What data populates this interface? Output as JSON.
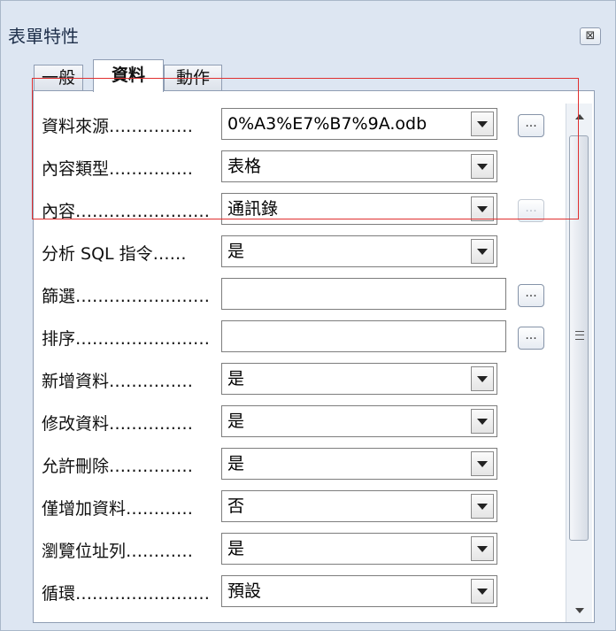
{
  "dialog": {
    "title": "表單特性",
    "close_label": "⊠"
  },
  "tabs": [
    {
      "label": "一般",
      "active": false
    },
    {
      "label": "資料",
      "active": true
    },
    {
      "label": "動作",
      "active": false
    }
  ],
  "rows": [
    {
      "label": "資料來源……………",
      "value": "0%A3%E7%B7%9A.odb",
      "control": "dropdown",
      "more_button": true,
      "more_label": "..."
    },
    {
      "label": "內容類型……………",
      "value": "表格",
      "control": "dropdown",
      "more_button": false
    },
    {
      "label": "內容……………………",
      "value": "通訊錄",
      "control": "dropdown",
      "more_button": true,
      "more_disabled": true,
      "more_label": "..."
    },
    {
      "label": "分析 SQL 指令……",
      "value": "是",
      "control": "dropdown",
      "more_button": false
    },
    {
      "label": "篩選……………………",
      "value": "",
      "control": "text",
      "more_button": true,
      "more_label": "..."
    },
    {
      "label": "排序……………………",
      "value": "",
      "control": "text",
      "more_button": true,
      "more_label": "..."
    },
    {
      "label": "新增資料……………",
      "value": "是",
      "control": "dropdown",
      "more_button": false
    },
    {
      "label": "修改資料……………",
      "value": "是",
      "control": "dropdown",
      "more_button": false
    },
    {
      "label": "允許刪除……………",
      "value": "是",
      "control": "dropdown",
      "more_button": false
    },
    {
      "label": "僅增加資料…………",
      "value": "否",
      "control": "dropdown",
      "more_button": false
    },
    {
      "label": "瀏覽位址列…………",
      "value": "是",
      "control": "dropdown",
      "more_button": false
    },
    {
      "label": "循環……………………",
      "value": "預設",
      "control": "dropdown",
      "more_button": false
    }
  ]
}
